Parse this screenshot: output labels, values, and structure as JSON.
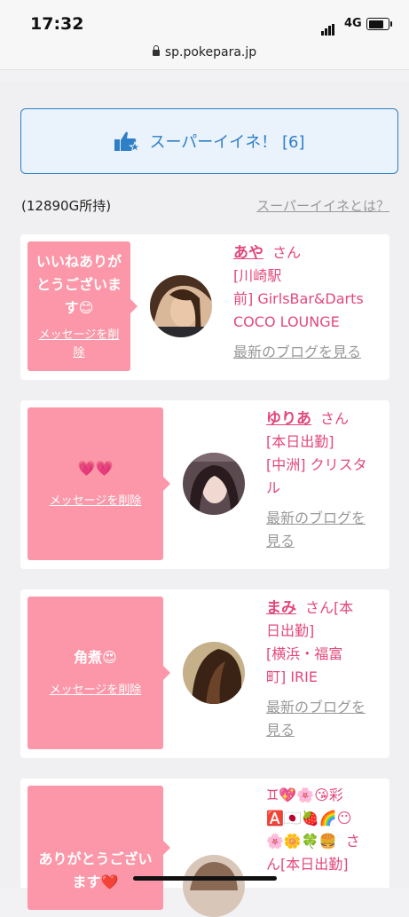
{
  "status": {
    "time": "17:32",
    "network": "4G",
    "url": "sp.pokepara.jp"
  },
  "super_like": {
    "label": "スーパーイイネ！ [6]"
  },
  "points_text": "(12890G所持)",
  "about_link": "スーパーイイネとは？",
  "blog_label": "最新のブログを見る",
  "delete_label": "メッセージを削除",
  "cards": [
    {
      "message_line1": "いいねありが",
      "message_line2": "とうございま",
      "message_line3": "す😊",
      "name": "あや",
      "honorific": "さん",
      "shop_line1": "[川崎駅",
      "shop_line2": "前] GirlsBar&Darts",
      "shop_line3": "COCO LOUNGE"
    },
    {
      "message": "💗💗",
      "name": "ゆりあ",
      "honorific": "さん",
      "shop_line1": "[本日出勤]",
      "shop_line2": "[中洲] クリスタ",
      "shop_line3": "ル",
      "blog_line1": "最新のブログを",
      "blog_line2": "見る"
    },
    {
      "message": "角煮😍",
      "name": "まみ",
      "honorific": "さん[本",
      "shop_line1": "日出勤]",
      "shop_line2": "[横浜・福富",
      "shop_line3": "町] IRIE",
      "blog_line1": "最新のブログを",
      "blog_line2": "見る"
    },
    {
      "message_line1": "ありがとうござい",
      "message_line2": "ます❤️",
      "name_line1": "♊💖🌸😘彩",
      "name_line2": "🅰️🇯🇵🍓🌈😶",
      "name_line3": "🌸🌼🍀🍔",
      "honorific": "さ",
      "shop_line1": "ん[本日出勤]"
    }
  ]
}
